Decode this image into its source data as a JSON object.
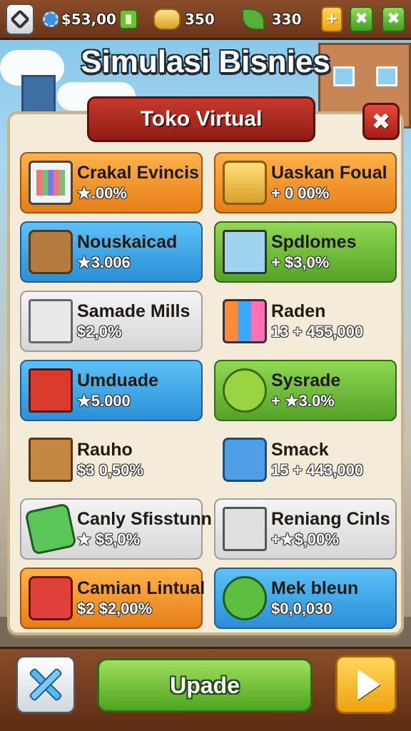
{
  "topbar": {
    "money": "$53,00",
    "coins": "350",
    "eco_points": "330",
    "plus_label": "+",
    "settings_label": "✖",
    "close_label": "✖"
  },
  "title": "Simulasi Bisnies",
  "panel": {
    "header": "Toko Virtual",
    "close_label": "✖"
  },
  "items": [
    {
      "name": "Crakal Evincis",
      "value": "★.00%",
      "color": "orange",
      "icon": "shopping-bag-icon"
    },
    {
      "name": "Uaskan Foual",
      "value": "+ 0 00%",
      "color": "orange",
      "icon": "money-stack-icon"
    },
    {
      "name": "Nouskaicad",
      "value": "★3.006",
      "color": "blue",
      "icon": "basket-icon"
    },
    {
      "name": "Spdlomes",
      "value": "+ $3,0%",
      "color": "green",
      "icon": "laptop-icon"
    },
    {
      "name": "Samade Mills",
      "value": "$2,0%",
      "color": "gray",
      "icon": "shopping-cart-icon"
    },
    {
      "name": "Raden",
      "value": "13 + 455,000",
      "color": "plain",
      "icon": "toy-blocks-icon"
    },
    {
      "name": "Umduade",
      "value": "★5.000",
      "color": "blue",
      "icon": "crate-icon"
    },
    {
      "name": "Sysrade",
      "value": "+ ★3.0%",
      "color": "green",
      "icon": "fruit-icon"
    },
    {
      "name": "Rauho",
      "value": "$3 0,50%",
      "color": "plain",
      "icon": "cardboard-box-icon"
    },
    {
      "name": "Smack",
      "value": "15 + 443,000",
      "color": "plain",
      "icon": "mug-icon"
    },
    {
      "name": "Canly Sfisstunn",
      "value": "★ $5,0%",
      "color": "gray",
      "icon": "phone-icon"
    },
    {
      "name": "Reniang Cinls",
      "value": "+★$,00%",
      "color": "gray",
      "icon": "cart-full-icon"
    },
    {
      "name": "Camian Lintual",
      "value": "$2 $2,00%",
      "color": "orange",
      "icon": "apple-basket-icon"
    },
    {
      "name": "Mek bleun",
      "value": "$0,0,030",
      "color": "blue",
      "icon": "puzzle-icon"
    }
  ],
  "bottombar": {
    "update_label": "Upade"
  },
  "colors": {
    "wood": "#8a4d2a",
    "panel_bg": "#f4ecd8",
    "header_red": "#c73a2c",
    "accent_green": "#54a226",
    "accent_orange": "#e67e17",
    "accent_blue": "#2a8fd8"
  }
}
